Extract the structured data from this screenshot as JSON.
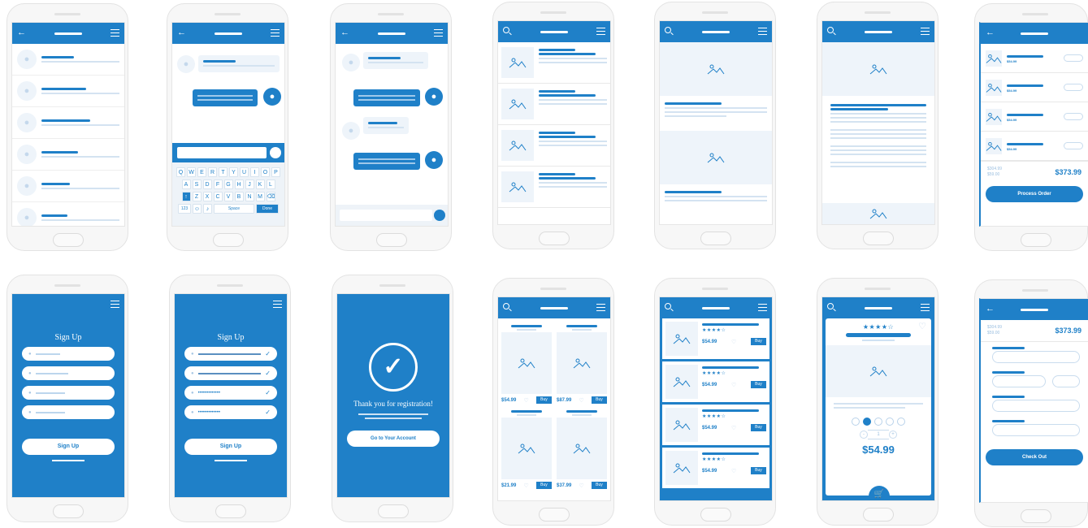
{
  "keyboard": {
    "row1": [
      "Q",
      "W",
      "E",
      "R",
      "T",
      "Y",
      "U",
      "I",
      "O",
      "P"
    ],
    "row2": [
      "A",
      "S",
      "D",
      "F",
      "G",
      "H",
      "J",
      "K",
      "L"
    ],
    "row3": [
      "Z",
      "X",
      "C",
      "V",
      "B",
      "N",
      "M"
    ],
    "num_key": "123",
    "space_key": "Space",
    "done_key": "Done"
  },
  "cart": {
    "items": [
      {
        "price": "$54.99"
      },
      {
        "price": "$54.99"
      },
      {
        "price": "$54.99"
      },
      {
        "price": "$54.99"
      }
    ],
    "old_price": "$304.99",
    "discount": "$59.00",
    "total": "$373.99",
    "process_label": "Process Order"
  },
  "signup": {
    "title": "Sign Up",
    "button_label": "Sign Up"
  },
  "signup_filled": {
    "title": "Sign Up",
    "email_dots": "•••••••••••••",
    "password_dots": "•••••••••••••",
    "button_label": "Sign Up"
  },
  "registration": {
    "message": "Thank you for registration!",
    "button_label": "Go to Your Account"
  },
  "grid": {
    "items": [
      {
        "price": "$54.99",
        "buy": "Buy"
      },
      {
        "price": "$87.99",
        "buy": "Buy"
      },
      {
        "price": "$21.99",
        "buy": "Buy"
      },
      {
        "price": "$37.99",
        "buy": "Buy"
      }
    ]
  },
  "product_list": {
    "items": [
      {
        "price": "$54.99",
        "buy": "Buy"
      },
      {
        "price": "$54.99",
        "buy": "Buy"
      },
      {
        "price": "$54.99",
        "buy": "Buy"
      },
      {
        "price": "$54.99",
        "buy": "Buy"
      }
    ]
  },
  "product_detail": {
    "rating": "★★★★☆",
    "qty_minus": "-",
    "qty_value": "1",
    "qty_plus": "+",
    "price": "$54.99"
  },
  "checkout": {
    "old_price": "$304.99",
    "discount": "$59.00",
    "total": "$373.99",
    "button_label": "Check Out"
  },
  "icons": {
    "back": "←",
    "star": "★",
    "heart": "♡",
    "check": "✓",
    "user": "👤",
    "cart": "🛒"
  },
  "colors": {
    "primary": "#1f80c8",
    "light": "#d7e7f5"
  }
}
